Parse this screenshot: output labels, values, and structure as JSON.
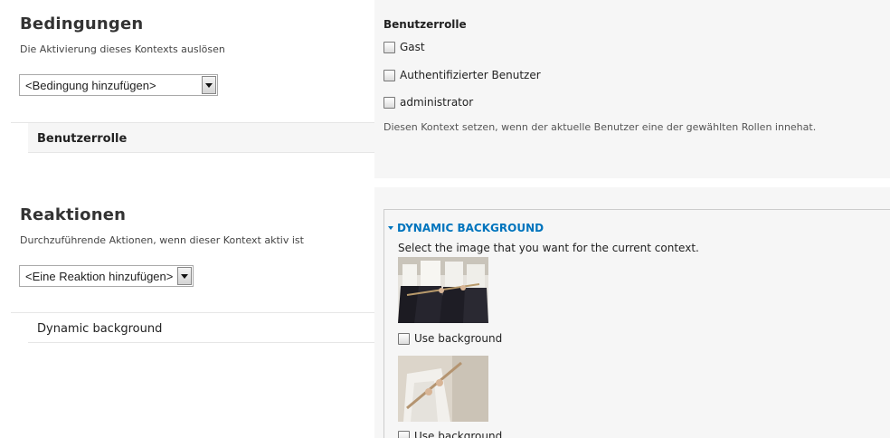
{
  "conditions": {
    "title": "Bedingungen",
    "description": "Die Aktivierung dieses Kontexts auslösen",
    "select_value": "<Bedingung hinzufügen>",
    "items": [
      "Benutzerrolle"
    ]
  },
  "reactions": {
    "title": "Reaktionen",
    "description": "Durchzuführende Aktionen, wenn dieser Kontext aktiv ist",
    "select_value": "<Eine Reaktion hinzufügen>",
    "items": [
      "Dynamic background"
    ]
  },
  "role_panel": {
    "heading": "Benutzerrolle",
    "options": [
      "Gast",
      "Authentifizierter Benutzer",
      "administrator"
    ],
    "help": "Diesen Kontext setzen, wenn der aktuelle Benutzer eine der gewählten Rollen innehat."
  },
  "background_panel": {
    "legend": "DYNAMIC BACKGROUND",
    "description": "Select the image that you want for the current context.",
    "images": [
      {
        "checkbox_label": "Use background"
      },
      {
        "checkbox_label": "Use background"
      }
    ]
  }
}
